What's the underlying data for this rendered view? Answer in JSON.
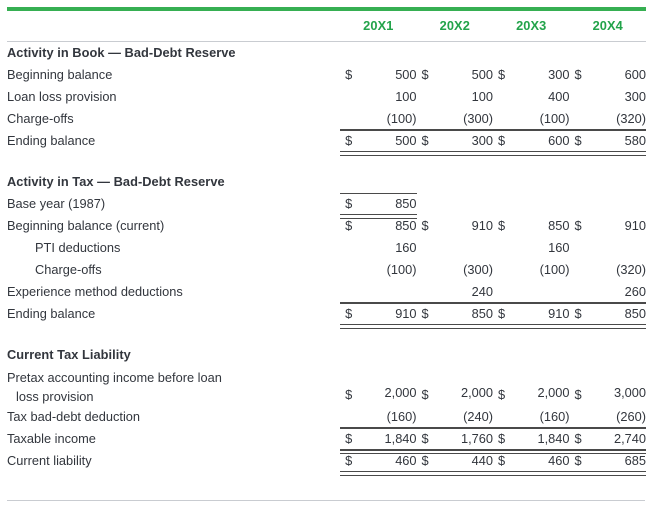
{
  "theme": {
    "accent_green": "#36af52",
    "header_green": "#22a34a",
    "text": "#32363d",
    "rule": "#4a4a4a",
    "light_rule": "#c9ccd1"
  },
  "table": {
    "row_label_header": "",
    "columns": [
      "20X1",
      "20X2",
      "20X3",
      "20X4"
    ],
    "sections": [
      {
        "title": "Activity in Book — Bad-Debt Reserve",
        "rows": [
          {
            "label": "Beginning balance",
            "cells": [
              {
                "cur": "$",
                "val": "500"
              },
              {
                "cur": "$",
                "val": "500"
              },
              {
                "cur": "$",
                "val": "300"
              },
              {
                "cur": "$",
                "val": "600"
              }
            ]
          },
          {
            "label": "Loan loss provision",
            "cells": [
              {
                "cur": "",
                "val": "100"
              },
              {
                "cur": "",
                "val": "100"
              },
              {
                "cur": "",
                "val": "400"
              },
              {
                "cur": "",
                "val": "300"
              }
            ]
          },
          {
            "label": "Charge-offs",
            "rule": "single",
            "cells": [
              {
                "cur": "",
                "val": "(100)"
              },
              {
                "cur": "",
                "val": "(300)"
              },
              {
                "cur": "",
                "val": "(100)"
              },
              {
                "cur": "",
                "val": "(320)"
              }
            ]
          },
          {
            "label": "Ending balance",
            "rule": "double",
            "cells": [
              {
                "cur": "$",
                "val": "500"
              },
              {
                "cur": "$",
                "val": "300"
              },
              {
                "cur": "$",
                "val": "600"
              },
              {
                "cur": "$",
                "val": "580"
              }
            ]
          }
        ]
      },
      {
        "title": "Activity in Tax — Bad-Debt Reserve",
        "rows": [
          {
            "label": "Base year (1987)",
            "rule": "double",
            "cells": [
              {
                "cur": "$",
                "val": "850"
              },
              {
                "cur": "",
                "val": ""
              },
              {
                "cur": "",
                "val": ""
              },
              {
                "cur": "",
                "val": ""
              }
            ]
          },
          {
            "label": "Beginning balance (current)",
            "cells": [
              {
                "cur": "$",
                "val": "850"
              },
              {
                "cur": "$",
                "val": "910"
              },
              {
                "cur": "$",
                "val": "850"
              },
              {
                "cur": "$",
                "val": "910"
              }
            ]
          },
          {
            "label": "PTI deductions",
            "indent": true,
            "cells": [
              {
                "cur": "",
                "val": "160"
              },
              {
                "cur": "",
                "val": ""
              },
              {
                "cur": "",
                "val": "160"
              },
              {
                "cur": "",
                "val": ""
              }
            ]
          },
          {
            "label": "Charge-offs",
            "indent": true,
            "cells": [
              {
                "cur": "",
                "val": "(100)"
              },
              {
                "cur": "",
                "val": "(300)"
              },
              {
                "cur": "",
                "val": "(100)"
              },
              {
                "cur": "",
                "val": "(320)"
              }
            ]
          },
          {
            "label": "Experience method deductions",
            "rule": "single",
            "cells": [
              {
                "cur": "",
                "val": ""
              },
              {
                "cur": "",
                "val": "240"
              },
              {
                "cur": "",
                "val": ""
              },
              {
                "cur": "",
                "val": "260"
              }
            ]
          },
          {
            "label": "Ending balance",
            "rule": "double",
            "cells": [
              {
                "cur": "$",
                "val": "910"
              },
              {
                "cur": "$",
                "val": "850"
              },
              {
                "cur": "$",
                "val": "910"
              },
              {
                "cur": "$",
                "val": "850"
              }
            ]
          }
        ]
      },
      {
        "title": "Current Tax Liability",
        "rows": [
          {
            "label": "Pretax accounting income before loan",
            "label_line2": "loss provision",
            "wrap": true,
            "cells": [
              {
                "cur": "$",
                "val": "2,000"
              },
              {
                "cur": "$",
                "val": "2,000"
              },
              {
                "cur": "$",
                "val": "2,000"
              },
              {
                "cur": "$",
                "val": "3,000"
              }
            ]
          },
          {
            "label": "Tax bad-debt deduction",
            "rule": "single",
            "cells": [
              {
                "cur": "",
                "val": "(160)"
              },
              {
                "cur": "",
                "val": "(240)"
              },
              {
                "cur": "",
                "val": "(160)"
              },
              {
                "cur": "",
                "val": "(260)"
              }
            ]
          },
          {
            "label": "Taxable income",
            "rule": "double",
            "cells": [
              {
                "cur": "$",
                "val": "1,840"
              },
              {
                "cur": "$",
                "val": "1,760"
              },
              {
                "cur": "$",
                "val": "1,840"
              },
              {
                "cur": "$",
                "val": "2,740"
              }
            ]
          },
          {
            "label": "Current liability",
            "rule": "double",
            "cells": [
              {
                "cur": "$",
                "val": "460"
              },
              {
                "cur": "$",
                "val": "440"
              },
              {
                "cur": "$",
                "val": "460"
              },
              {
                "cur": "$",
                "val": "685"
              }
            ]
          }
        ]
      }
    ]
  }
}
